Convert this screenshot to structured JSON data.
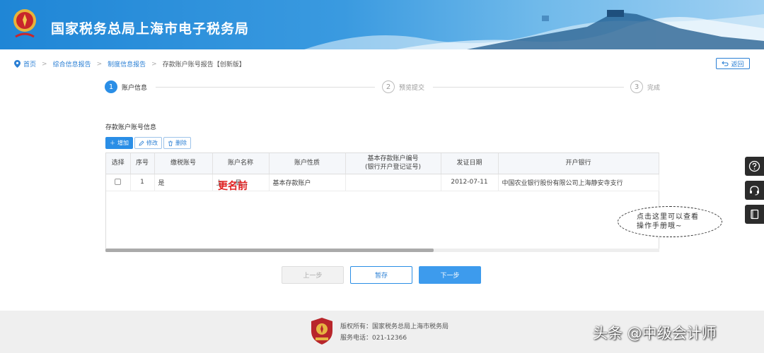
{
  "header": {
    "title": "国家税务总局上海市电子税务局",
    "colors": {
      "primary": "#1f86d6",
      "accent": "#2a8ee6"
    }
  },
  "breadcrumb": {
    "home": "首页",
    "items": [
      "综合信息报告",
      "制度信息报告",
      "存款账户账号报告【创新版】"
    ],
    "back": "返回"
  },
  "steps": [
    {
      "num": "1",
      "label": "账户信息",
      "state": "active"
    },
    {
      "num": "2",
      "label": "预览提交",
      "state": "idle"
    },
    {
      "num": "3",
      "label": "完成",
      "state": "idle"
    }
  ],
  "section": {
    "title": "存款账户账号信息",
    "add": "增加",
    "edit": "修改",
    "delete": "删除"
  },
  "table": {
    "headers": [
      "选择",
      "序号",
      "缴税账号",
      "账户名称",
      "账户性质",
      "基本存款账户编号",
      "(银行开户登记证号)",
      "发证日期",
      "开户银行"
    ],
    "rows": [
      {
        "seq": "1",
        "tax_account": "是",
        "name": "上……局…",
        "nature": "基本存款账户",
        "basic_no": "",
        "date": "2012-07-11",
        "bank": "中国农业银行股份有限公司上海静安寺支行"
      }
    ],
    "overlay_note": "更名前"
  },
  "callout": {
    "line1": "点击这里可以查看",
    "line2": "操作手册哦~"
  },
  "buttons": {
    "prev": "上一步",
    "save": "暂存",
    "next": "下一步"
  },
  "footer": {
    "copyright": "版权所有：国家税务总局上海市税务局",
    "phone": "服务电话：021-12366"
  },
  "watermark": "头条 @中级会计师",
  "icons": [
    "location-pin-icon",
    "back-arrow-icon",
    "plus-icon",
    "edit-icon",
    "trash-icon",
    "help-icon",
    "headset-icon",
    "manual-book-icon",
    "tax-emblem-icon"
  ]
}
